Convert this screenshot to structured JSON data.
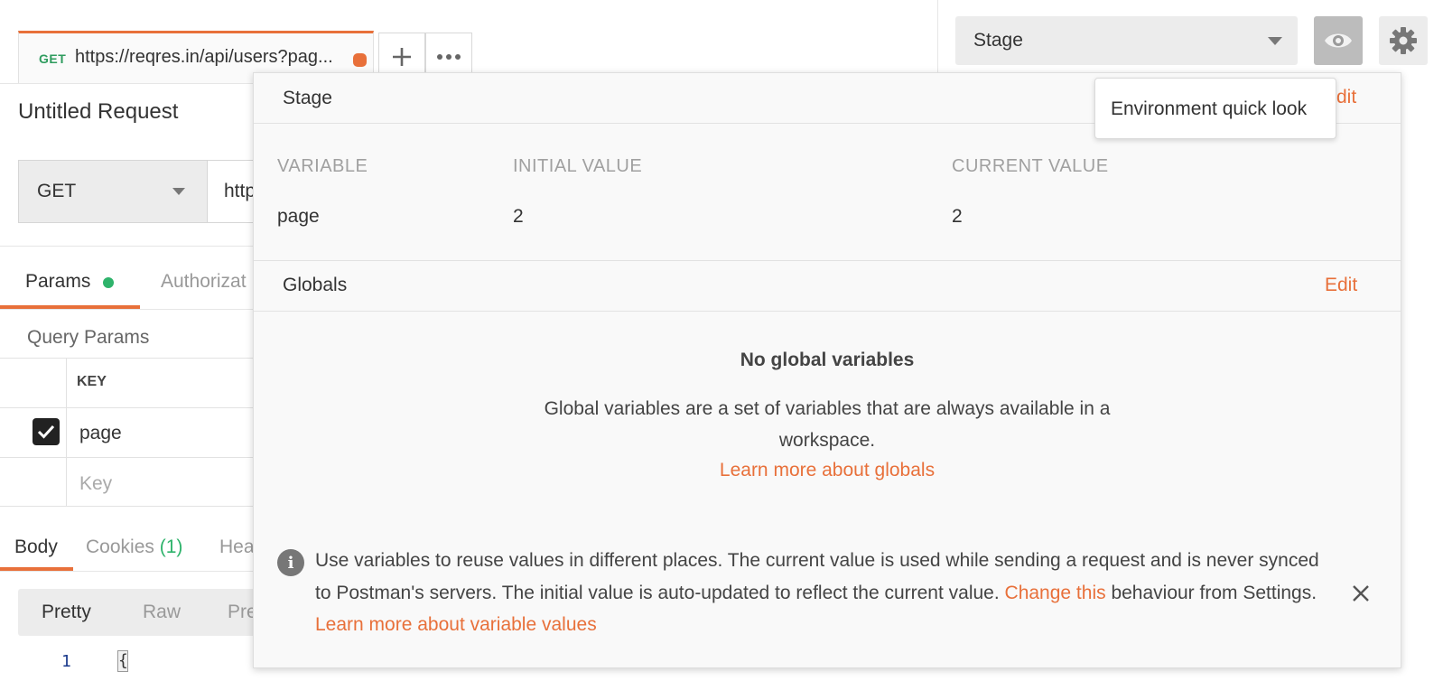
{
  "tab": {
    "method": "GET",
    "url": "https://reqres.in/api/users?pag...",
    "add_icon": "plus-icon",
    "more_icon": "ellipsis-icon"
  },
  "environment": {
    "selected": "Stage",
    "eye_icon": "eye-icon",
    "gear_icon": "gear-icon"
  },
  "request": {
    "title": "Untitled Request",
    "method": "GET",
    "url_partial": "http",
    "tabs": [
      "Params",
      "Authorizat"
    ],
    "query_params_title": "Query Params",
    "key_header": "KEY",
    "rows": [
      {
        "key": "page",
        "checked": true
      }
    ],
    "key_placeholder": "Key"
  },
  "response": {
    "tabs": {
      "body": "Body",
      "cookies": "Cookies",
      "cookies_count": "(1)",
      "headers": "Hea"
    },
    "formats": [
      "Pretty",
      "Raw",
      "Pre"
    ],
    "line_number": "1",
    "code_first_char": "{"
  },
  "quicklook": {
    "env_name": "Stage",
    "edit_label": "Edit",
    "edit_partial": "dit",
    "columns": {
      "variable": "VARIABLE",
      "initial": "INITIAL VALUE",
      "current": "CURRENT VALUE"
    },
    "variables": [
      {
        "name": "page",
        "initial": "2",
        "current": "2"
      }
    ],
    "globals_title": "Globals",
    "globals_edit": "Edit",
    "empty_title": "No global variables",
    "empty_desc": "Global variables are a set of variables that are always available in a workspace.",
    "learn_globals": "Learn more about globals",
    "info_part1": "Use variables to reuse values in different places. The current value is used while sending a request and is never synced to Postman's servers. The initial value is auto-updated to reflect the current value. ",
    "info_link1": "Change this",
    "info_part2": " behaviour from Settings. ",
    "info_link2": "Learn more about variable values"
  },
  "tooltip": {
    "text": "Environment quick look"
  },
  "colors": {
    "accent": "#e8703a",
    "success": "#2eb36b"
  }
}
